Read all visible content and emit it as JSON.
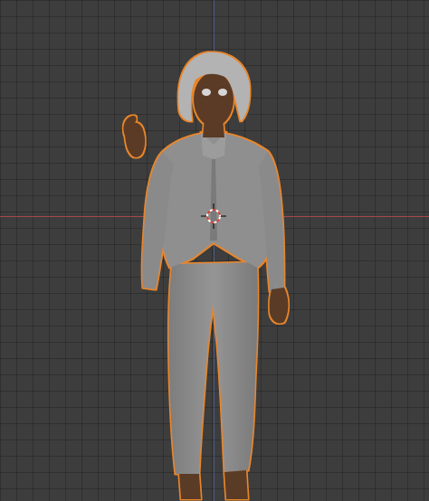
{
  "viewport": {
    "background_color": "#3d3d3d",
    "grid_color": "#2f2f2f",
    "x_axis_color": "#a4474e",
    "y_axis_color": "#5068a5"
  },
  "scene": {
    "selected_object": "character",
    "selection_outline_color": "#e8862a",
    "body_color": "#8a8a8a",
    "skin_color": "#5a3a25",
    "hair_color": "#b3b3b3",
    "icons": [
      "3d-cursor-icon"
    ]
  }
}
